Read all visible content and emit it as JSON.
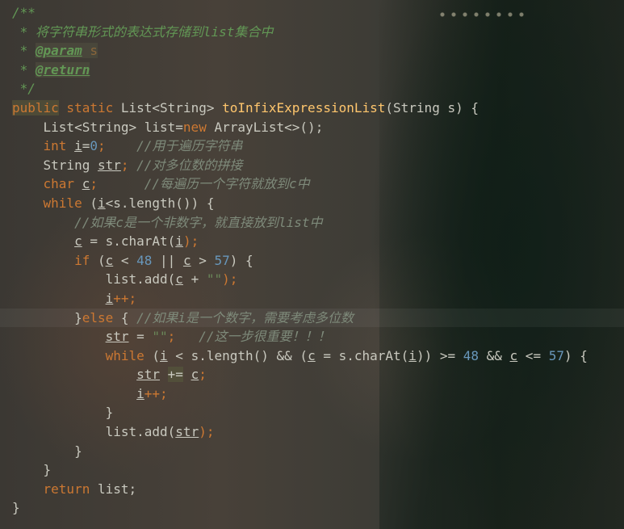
{
  "editor": {
    "theme_colors": {
      "keyword": "#cc7832",
      "function": "#ffc66d",
      "number": "#6897bb",
      "string": "#6a8759",
      "doc_comment": "#629755",
      "line_comment": "#7e8a7a",
      "text": "#c9c9bf"
    },
    "code": {
      "doc_open": "/**",
      "doc_desc": " * 将字符串形式的表达式存储到list集合中",
      "doc_param_prefix": " * ",
      "doc_param_tag": "@param",
      "doc_param_arg": "s",
      "doc_return_prefix": " * ",
      "doc_return_tag": "@return",
      "doc_close": " */",
      "sig_public": "public",
      "sig_static": " static",
      "sig_type": " List<String> ",
      "sig_name": "toInfixExpressionList",
      "sig_params": "(String s) {",
      "l1_type": "    List<String> list=",
      "l1_new": "new",
      "l1_rest": " ArrayList<>();",
      "l2_int": "    int",
      "l2_var": "i",
      "l2_eq": "=",
      "l2_num": "0",
      "l2_semi": ";    ",
      "l2_comment": "//用于遍历字符串",
      "l3_type": "    String ",
      "l3_var": "str",
      "l3_semi": "; ",
      "l3_comment": "//对多位数的拼接",
      "l4_char": "    char",
      "l4_sp": " ",
      "l4_var": "c",
      "l4_semi": ";      ",
      "l4_comment": "//每遍历一个字符就放到c中",
      "w1_kw": "    while",
      "w1_open": " (",
      "w1_i": "i",
      "w1_rest": "<s.length()) {",
      "c1_comment": "        //如果c是一个非数字，就直接放到list中",
      "a1_indent": "        ",
      "a1_c": "c",
      "a1_mid": " = s.charAt(",
      "a1_i": "i",
      "a1_end": ");",
      "if_kw": "        if",
      "if_open": " (",
      "if_c1": "c",
      "if_lt": " < ",
      "if_48": "48",
      "if_or": " || ",
      "if_c2": "c",
      "if_gt": " > ",
      "if_57": "57",
      "if_close": ") {",
      "add1_pre": "            list.add(",
      "add1_c": "c",
      "add1_plus": " + ",
      "add1_str": "\"\"",
      "add1_end": ");",
      "inc1_indent": "            ",
      "inc1_i": "i",
      "inc1_end": "++;",
      "else_brace": "        }",
      "else_kw": "else",
      "else_rest": " { ",
      "else_comment": "//如果i是一个数字，需要考虑多位数",
      "s1_indent": "            ",
      "s1_str": "str",
      "s1_eq": " = ",
      "s1_val": "\"\"",
      "s1_semi": ";   ",
      "s1_comment": "//这一步很重要！！！",
      "w2_kw": "            while",
      "w2_open": " (",
      "w2_i": "i",
      "w2_mid": " < s.length() && (",
      "w2_c": "c",
      "w2_mid2": " = s.charAt(",
      "w2_i2": "i",
      "w2_mid3": ")) >= ",
      "w2_48": "48",
      "w2_and": " && ",
      "w2_c2": "c",
      "w2_le": " <= ",
      "w2_57": "57",
      "w2_close": ") {",
      "p1_indent": "                ",
      "p1_str": "str",
      "p1_sp": " ",
      "p1_op": "+=",
      "p1_sp2": " ",
      "p1_c": "c",
      "p1_semi": ";",
      "inc2_indent": "                ",
      "inc2_i": "i",
      "inc2_end": "++;",
      "w2_end": "            }",
      "add2_pre": "            list.add(",
      "add2_str": "str",
      "add2_end": ");",
      "else_end": "        }",
      "w1_end": "    }",
      "ret_indent": "    ",
      "ret_kw": "return",
      "ret_rest": " list;",
      "fn_end": "}"
    }
  }
}
